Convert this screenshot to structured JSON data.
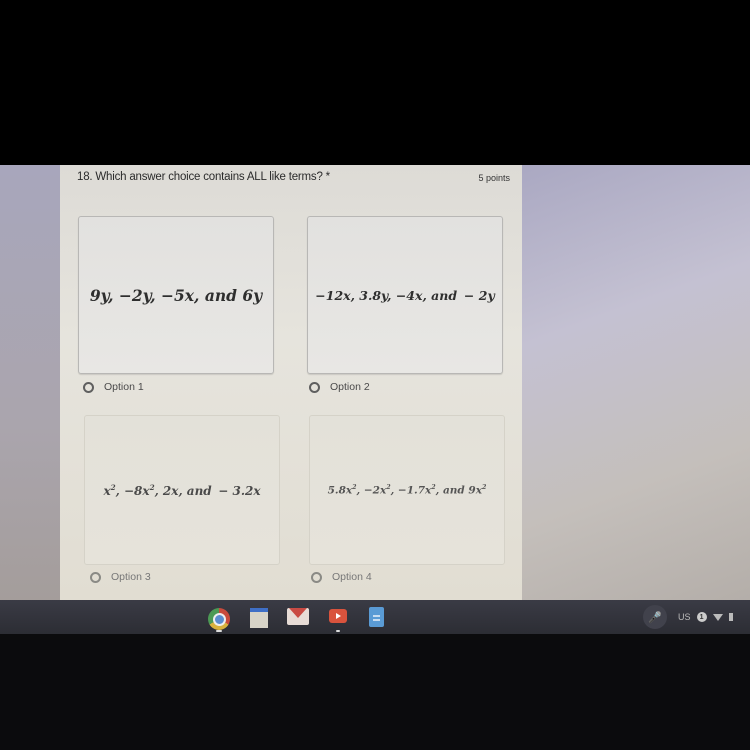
{
  "question": {
    "title": "18. Which answer choice contains ALL like terms?",
    "required_marker": "*",
    "points": "5 points"
  },
  "choices": [
    {
      "parts": [
        "9y, −2y, −5x, and 6y"
      ],
      "label": "Option 1",
      "selected": false
    },
    {
      "parts": [
        "−12x, 3.8y, −4x, and  − 2y"
      ],
      "label": "Option 2",
      "selected": false
    },
    {
      "text_a": "x",
      "text_b": ", −8x",
      "text_c": ", 2x, and  − 3.2x",
      "exp": "2",
      "label": "Option 3",
      "selected": false
    },
    {
      "t1": "5.8x",
      "t2": ", −2x",
      "t3": ", −1.7x",
      "t4": ", and 9x",
      "exp": "2",
      "label": "Option 4",
      "selected": false
    }
  ],
  "shelf": {
    "apps": [
      {
        "name": "Chrome",
        "icon": "chrome-icon",
        "running": true
      },
      {
        "name": "Google Classroom",
        "icon": "classroom-icon",
        "running": false
      },
      {
        "name": "Gmail",
        "icon": "gmail-icon",
        "running": false
      },
      {
        "name": "YouTube",
        "icon": "youtube-icon",
        "running": true
      },
      {
        "name": "Google Docs",
        "icon": "docs-icon",
        "running": false
      }
    ],
    "tray": {
      "ime": "US",
      "notification_count": "1"
    }
  },
  "colors": {
    "form_background": "#e4e2dc",
    "page_background": "#bdbacb",
    "shelf": "#33343c"
  }
}
